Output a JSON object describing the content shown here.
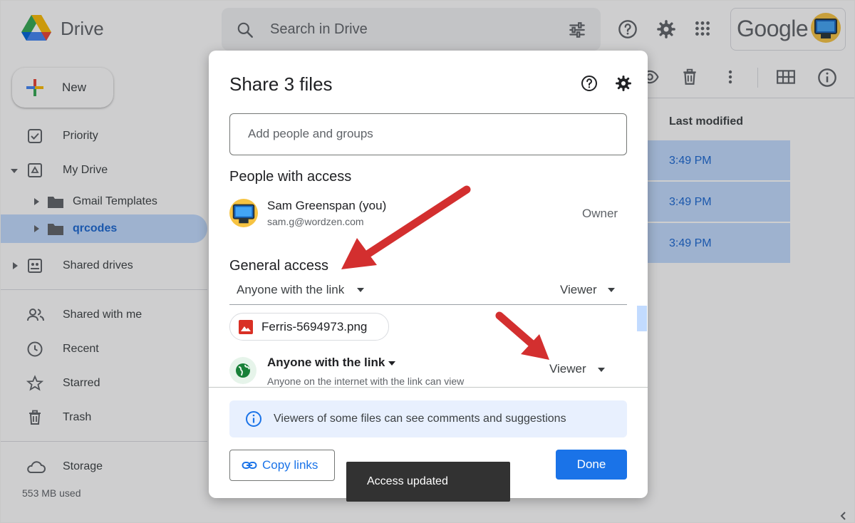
{
  "app": {
    "brand": "Drive",
    "search_placeholder": "Search in Drive",
    "google_wordmark": "Google",
    "icons": [
      "drive-logo-icon",
      "search-icon",
      "tune-icon",
      "help-icon",
      "gear-icon",
      "apps-grid-icon",
      "account-avatar"
    ]
  },
  "sidebar": {
    "new_label": "New",
    "items": [
      {
        "label": "Priority",
        "icon": "priority-checkbox-icon"
      },
      {
        "label": "My Drive",
        "icon": "my-drive-icon"
      },
      {
        "label": "Gmail Templates",
        "icon": "folder-icon"
      },
      {
        "label": "qrcodes",
        "icon": "folder-icon",
        "selected": true
      },
      {
        "label": "Shared drives",
        "icon": "shared-drives-icon"
      },
      {
        "label": "Shared with me",
        "icon": "people-icon"
      },
      {
        "label": "Recent",
        "icon": "clock-icon"
      },
      {
        "label": "Starred",
        "icon": "star-icon"
      },
      {
        "label": "Trash",
        "icon": "trash-icon"
      },
      {
        "label": "Storage",
        "icon": "cloud-icon"
      }
    ],
    "storage_used": "553 MB used"
  },
  "file_list": {
    "column_header": "Last modified",
    "rows": [
      "3:49 PM",
      "3:49 PM",
      "3:49 PM"
    ],
    "toolbar_icons": [
      "preview-eye-icon",
      "trash-icon",
      "more-vert-icon",
      "grid-view-icon",
      "info-icon"
    ]
  },
  "dialog": {
    "title": "Share 3 files",
    "add_placeholder": "Add people and groups",
    "people_heading": "People with access",
    "owner": {
      "name": "Sam Greenspan (you)",
      "email": "sam.g@wordzen.com",
      "role": "Owner"
    },
    "general_heading": "General access",
    "general_left": "Anyone with the link",
    "general_right": "Viewer",
    "file_chip": "Ferris-5694973.png",
    "link_access_title": "Anyone with the link",
    "link_access_sub": "Anyone on the internet with the link can view",
    "link_access_role": "Viewer",
    "info_text": "Viewers of some files can see comments and suggestions",
    "copy_label": "Copy links",
    "done_label": "Done"
  },
  "toast": "Access updated",
  "colors": {
    "accent": "#1a73e8",
    "selection": "#c2dbff",
    "annotation_arrow": "#d32f2f"
  }
}
